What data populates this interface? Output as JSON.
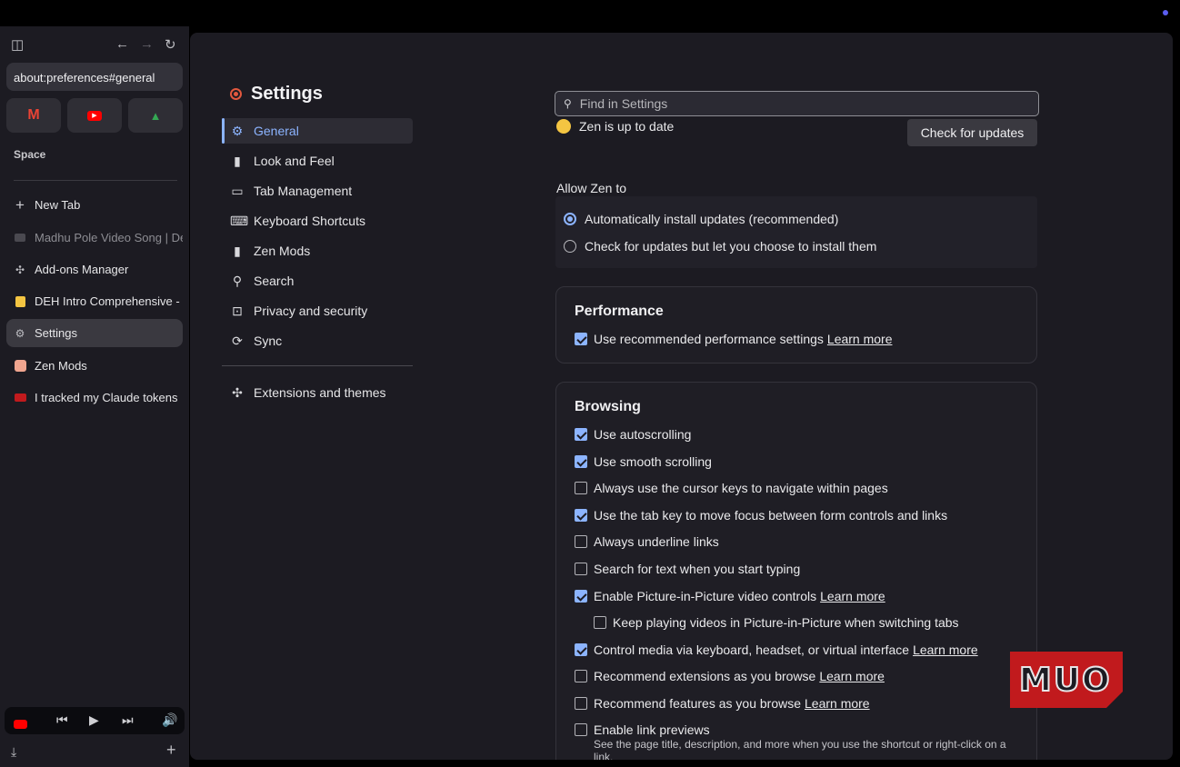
{
  "browser": {
    "url": "about:preferences#general",
    "space_label": "Space",
    "pinned": [
      {
        "name": "gmail",
        "glyph": "M",
        "color": "#ea4335"
      },
      {
        "name": "youtube",
        "glyph": "▶",
        "color": "#ff0000"
      },
      {
        "name": "google-drive",
        "glyph": "▲",
        "color": "#34a853"
      }
    ],
    "tabs": [
      {
        "label": "New Tab",
        "icon": "plus-icon"
      },
      {
        "label": "Madhu Pole Video Song | De",
        "icon": "video-icon"
      },
      {
        "label": "Add-ons Manager",
        "icon": "puzzle-icon"
      },
      {
        "label": "DEH Intro Comprehensive -",
        "icon": "note-icon"
      },
      {
        "label": "Settings",
        "icon": "gear-icon"
      },
      {
        "label": "Zen Mods",
        "icon": "zen-mods-icon"
      },
      {
        "label": "I tracked my Claude tokens",
        "icon": "muo-icon"
      }
    ]
  },
  "settings": {
    "title": "Settings",
    "search_placeholder": "Find in Settings",
    "categories": [
      {
        "label": "General",
        "icon": "gear-icon"
      },
      {
        "label": "Look and Feel",
        "icon": "brush-icon"
      },
      {
        "label": "Tab Management",
        "icon": "window-icon"
      },
      {
        "label": "Keyboard Shortcuts",
        "icon": "keyboard-icon"
      },
      {
        "label": "Zen Mods",
        "icon": "brush-icon"
      },
      {
        "label": "Search",
        "icon": "search-icon"
      },
      {
        "label": "Privacy and security",
        "icon": "lock-icon"
      },
      {
        "label": "Sync",
        "icon": "sync-icon"
      }
    ],
    "extensions_label": "Extensions and themes",
    "update_status": "Zen is up to date",
    "check_updates_label": "Check for updates",
    "allow_label": "Allow Zen to",
    "update_options": [
      {
        "label": "Automatically install updates (recommended)",
        "selected": true
      },
      {
        "label": "Check for updates but let you choose to install them",
        "selected": false
      }
    ],
    "performance": {
      "heading": "Performance",
      "items": [
        {
          "label": "Use recommended performance settings",
          "checked": true,
          "learn_more": "Learn more"
        }
      ]
    },
    "browsing": {
      "heading": "Browsing",
      "items": [
        {
          "label": "Use autoscrolling",
          "checked": true
        },
        {
          "label": "Use smooth scrolling",
          "checked": true
        },
        {
          "label": "Always use the cursor keys to navigate within pages",
          "checked": false
        },
        {
          "label": "Use the tab key to move focus between form controls and links",
          "checked": true
        },
        {
          "label": "Always underline links",
          "checked": false
        },
        {
          "label": "Search for text when you start typing",
          "checked": false
        },
        {
          "label": "Enable Picture-in-Picture video controls",
          "checked": true,
          "learn_more": "Learn more"
        },
        {
          "label": "Keep playing videos in Picture-in-Picture when switching tabs",
          "checked": false,
          "indent": true
        },
        {
          "label": "Control media via keyboard, headset, or virtual interface",
          "checked": true,
          "learn_more": "Learn more"
        },
        {
          "label": "Recommend extensions as you browse",
          "checked": false,
          "learn_more": "Learn more"
        },
        {
          "label": "Recommend features as you browse",
          "checked": false,
          "learn_more": "Learn more"
        },
        {
          "label": "Enable link previews",
          "checked": false
        }
      ],
      "link_preview_desc": "See the page title, description, and more when you use the shortcut or right-click on a link."
    }
  },
  "watermark": "MUO",
  "colors": {
    "accent": "#8cb4ff",
    "background": "#1c1b22",
    "watermark": "#c11a1d"
  }
}
